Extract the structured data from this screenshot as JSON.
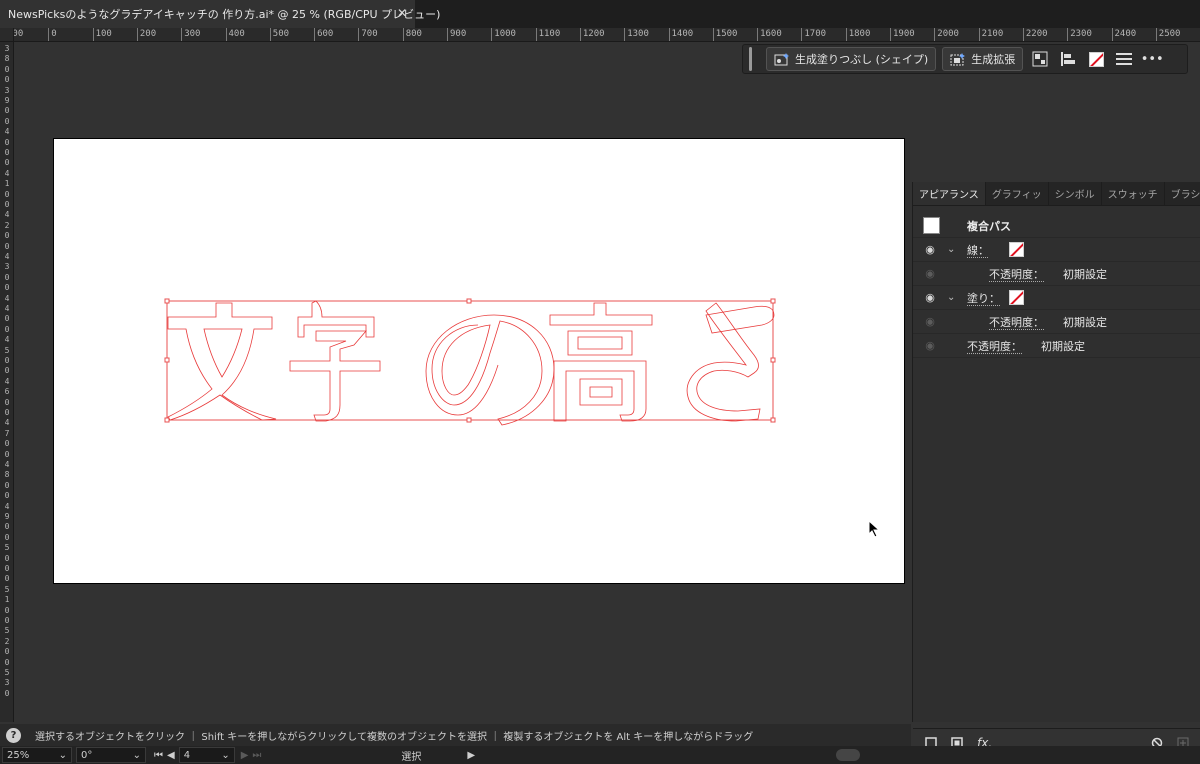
{
  "document_tab": {
    "title": "NewsPicksのようなグラデアイキャッチの 作り方.ai* @ 25 % (RGB/CPU プレビュー)",
    "close_glyph": "✕"
  },
  "ruler": {
    "h_labels": [
      "100",
      "0",
      "100",
      "200",
      "300",
      "400",
      "500",
      "600",
      "700",
      "800",
      "900",
      "1000",
      "1100",
      "1200",
      "1300",
      "1400",
      "1500",
      "1600",
      "1700",
      "1800",
      "1900",
      "2000",
      "2100",
      "2200",
      "2300",
      "2400",
      "2500"
    ],
    "v_labels": [
      "3",
      "8",
      "0",
      "0",
      "3",
      "9",
      "0",
      "0",
      "4",
      "0",
      "0",
      "0",
      "4",
      "1",
      "0",
      "0",
      "4",
      "2",
      "0",
      "0",
      "4",
      "3",
      "0",
      "0",
      "4",
      "4",
      "0",
      "0",
      "4",
      "5",
      "0",
      "0",
      "4",
      "6",
      "0",
      "0",
      "4",
      "7",
      "0",
      "0",
      "4",
      "8",
      "0",
      "0",
      "4",
      "9",
      "0",
      "0",
      "5",
      "0",
      "0",
      "0",
      "5",
      "1",
      "0",
      "0",
      "5",
      "2",
      "0",
      "0",
      "5",
      "3",
      "0"
    ]
  },
  "artwork": {
    "text": "文字の高さ",
    "outline_color": "#e83a3a",
    "selection_color": "#e85050"
  },
  "taskbar": {
    "generative_recolor_label": "生成塗りつぶし (シェイプ)",
    "generative_expand_label": "生成拡張",
    "more_glyph": "•••"
  },
  "panel": {
    "tabs": [
      "アピアランス",
      "グラフィッ",
      "シンボル",
      "スウォッチ",
      "ブラシ"
    ],
    "object_type": "複合パス",
    "stroke_label": "線：",
    "stroke_opacity_label": "不透明度：",
    "stroke_opacity_value": "初期設定",
    "fill_label": "塗り：",
    "fill_opacity_label": "不透明度：",
    "fill_opacity_value": "初期設定",
    "opacity_label": "不透明度：",
    "opacity_value": "初期設定",
    "fx_label": "fx."
  },
  "status": {
    "help_glyph": "?",
    "message": "選択するオブジェクトをクリック ｜ Shift キーを押しながらクリックして複数のオブジェクトを選択 ｜ 複製するオブジェクトを Alt キーを押しながらドラッグ"
  },
  "bottom": {
    "zoom": "25%",
    "rotation": "0°",
    "artboard_number": "4",
    "tool_name": "選択"
  },
  "colors": {
    "ui_bg": "#323232",
    "panel_bg": "#2f2f2f",
    "none_slash": "#e0101e"
  }
}
